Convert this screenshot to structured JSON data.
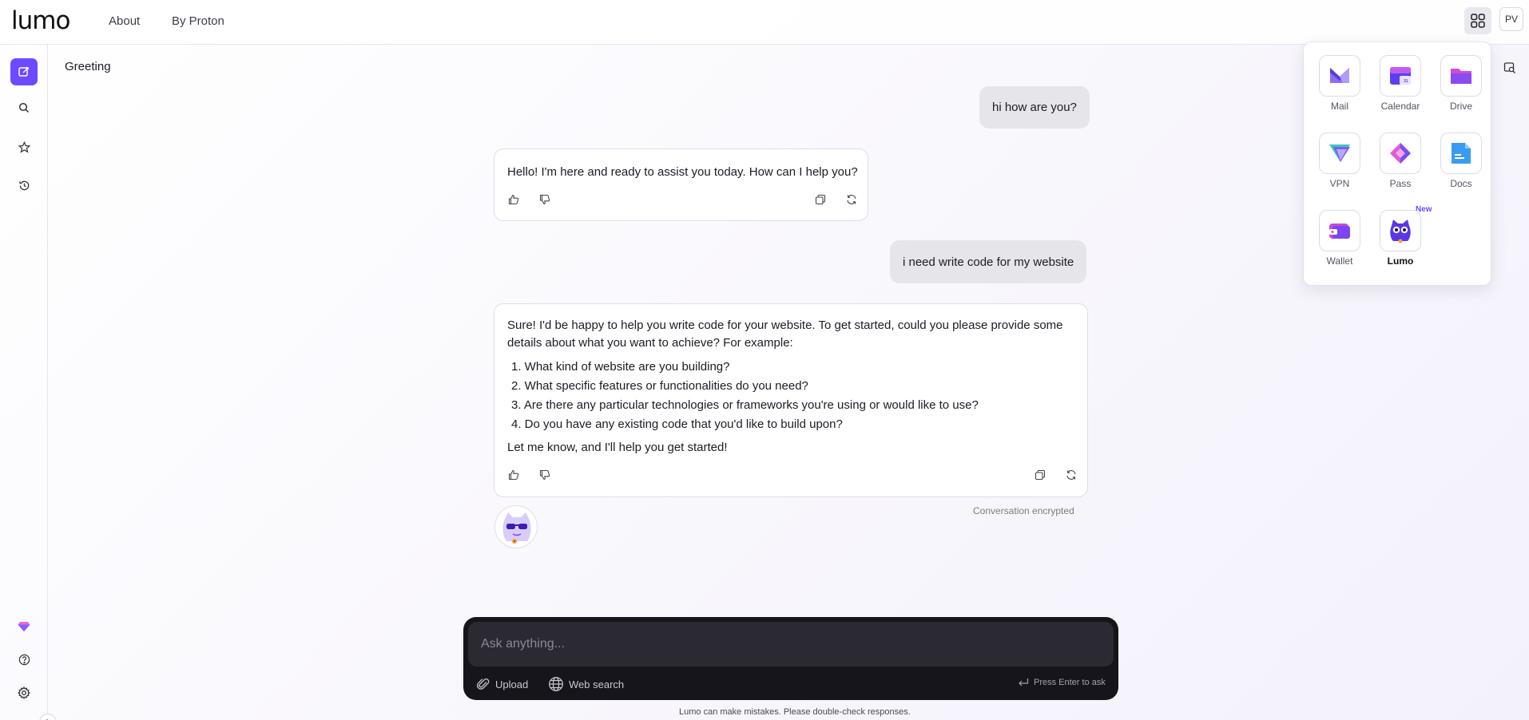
{
  "header": {
    "logo": "lumo",
    "nav": [
      "About",
      "By Proton"
    ],
    "avatar_initials": "PV"
  },
  "conversation": {
    "title": "Greeting",
    "messages": [
      {
        "role": "user",
        "text": "hi how are you?"
      },
      {
        "role": "assistant",
        "text": "Hello! I'm here and ready to assist you today. How can I help you?"
      },
      {
        "role": "user",
        "text": "i need write code for my website"
      },
      {
        "role": "assistant",
        "intro": "Sure! I'd be happy to help you write code for your website. To get started, could you please provide some details about what you want to achieve? For example:",
        "list": [
          "1. What kind of website are you building?",
          "2. What specific features or functionalities do you need?",
          "3. Are there any particular technologies or frameworks you're using or would like to use?",
          "4. Do you have any existing code that you'd like to build upon?"
        ],
        "outro": "Let me know, and I'll help you get started!"
      }
    ],
    "encrypted_note": "Conversation encrypted"
  },
  "composer": {
    "placeholder": "Ask anything...",
    "upload_label": "Upload",
    "web_search_label": "Web search",
    "enter_hint": "Press Enter to ask"
  },
  "disclaimer": "Lumo can make mistakes. Please double-check responses.",
  "apps": {
    "items": [
      {
        "label": "Mail",
        "icon": "mail-icon"
      },
      {
        "label": "Calendar",
        "icon": "calendar-icon"
      },
      {
        "label": "Drive",
        "icon": "drive-icon"
      },
      {
        "label": "VPN",
        "icon": "vpn-icon"
      },
      {
        "label": "Pass",
        "icon": "pass-icon"
      },
      {
        "label": "Docs",
        "icon": "docs-icon"
      },
      {
        "label": "Wallet",
        "icon": "wallet-icon"
      },
      {
        "label": "Lumo",
        "icon": "lumo-icon",
        "badge": "New",
        "current": true
      }
    ],
    "calendar_day": "31"
  },
  "colors": {
    "accent": "#6d4aff",
    "user_bubble": "#e6e6ea",
    "composer_bg": "#16151c"
  }
}
